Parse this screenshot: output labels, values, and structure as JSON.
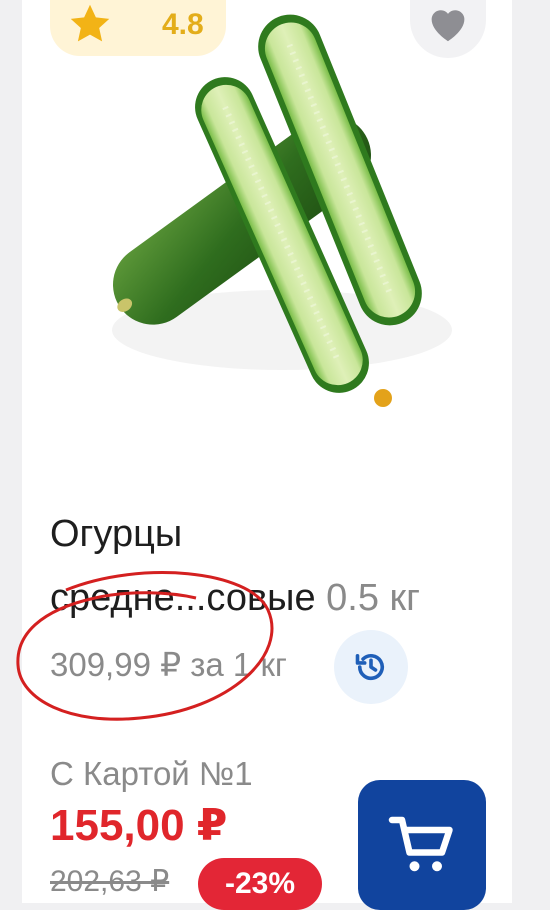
{
  "product": {
    "rating": "4.8",
    "name_line1": "Огурцы",
    "name_line2": "средне...совые",
    "weight": "0.5 кг",
    "unit_price": "309,99 ₽ за 1 кг",
    "card_label": "С Картой №1",
    "price": "155,00 ₽",
    "old_price": "202,63 ₽",
    "discount": "-23%"
  },
  "icons": {
    "rating": "star-icon",
    "favorite": "heart-icon",
    "history": "price-history-icon",
    "cart": "cart-icon"
  },
  "colors": {
    "price": "#e0262b",
    "discount_bg": "#e32636",
    "cart_bg": "#11449e",
    "rating": "#e3ad1a",
    "annotation": "#d42020"
  }
}
